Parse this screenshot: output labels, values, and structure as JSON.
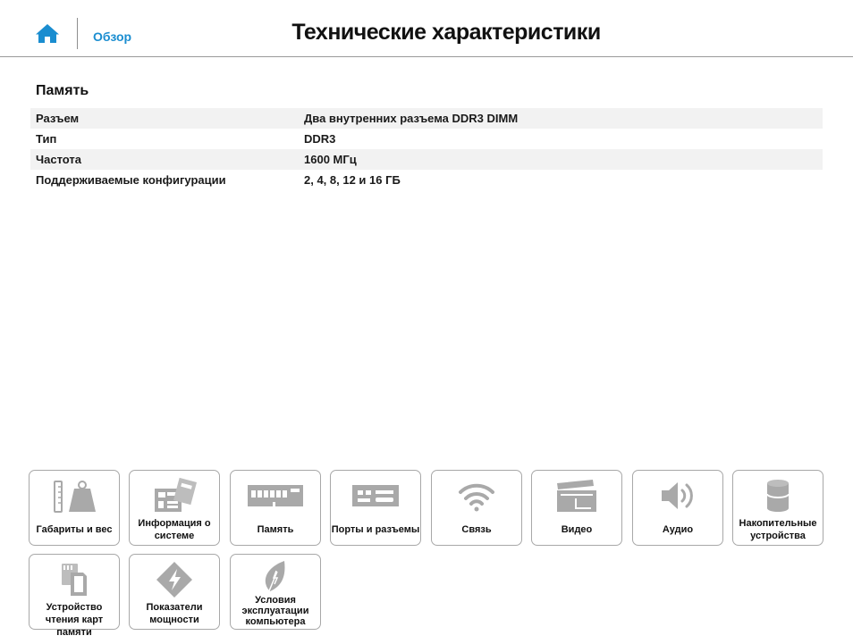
{
  "header": {
    "home_icon": "home-icon",
    "overview_label": "Обзор",
    "title": "Технические характеристики",
    "accent_color": "#1a8dd0"
  },
  "section": {
    "title": "Память",
    "rows": [
      {
        "label": "Разъем",
        "value": "Два внутренних разъема DDR3 DIMM"
      },
      {
        "label": "Тип",
        "value": "DDR3"
      },
      {
        "label": "Частота",
        "value": "1600 МГц"
      },
      {
        "label": "Поддерживаемые конфигурации",
        "value": "2, 4, 8, 12 и 16 ГБ"
      }
    ]
  },
  "tiles": [
    {
      "label": "Габариты и вес",
      "icon": "weight-ruler-icon"
    },
    {
      "label": "Информация о системе",
      "icon": "motherboard-icon"
    },
    {
      "label": "Память",
      "icon": "memory-module-icon"
    },
    {
      "label": "Порты и разъемы",
      "icon": "ports-icon"
    },
    {
      "label": "Связь",
      "icon": "wifi-icon"
    },
    {
      "label": "Видео",
      "icon": "clapperboard-icon"
    },
    {
      "label": "Аудио",
      "icon": "speaker-icon"
    },
    {
      "label": "Накопительные устройства",
      "icon": "storage-cylinder-icon"
    },
    {
      "label": "Устройство чтения карт памяти",
      "icon": "memory-card-icon"
    },
    {
      "label": "Показатели мощности",
      "icon": "power-bolt-icon"
    },
    {
      "label": "Условия эксплуатации компьютера",
      "icon": "leaf-icon"
    }
  ]
}
